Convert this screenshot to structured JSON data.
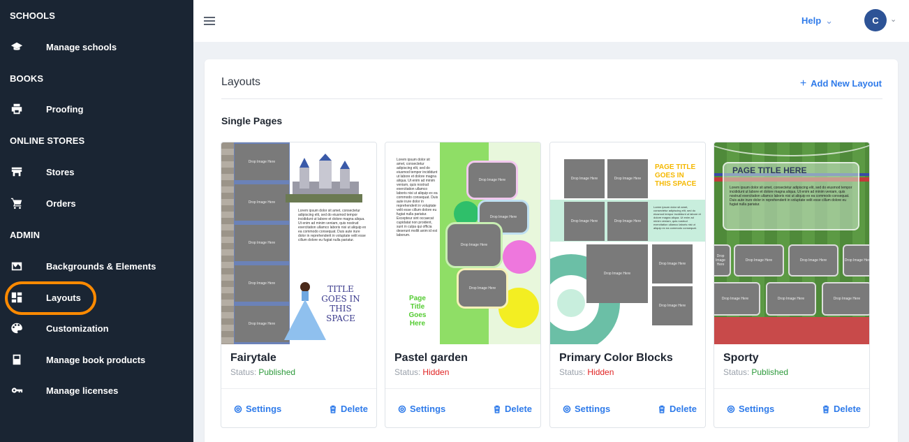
{
  "sidebar": {
    "sections": [
      {
        "title": "SCHOOLS"
      },
      {
        "title": "BOOKS"
      },
      {
        "title": "ONLINE STORES"
      },
      {
        "title": "ADMIN"
      }
    ],
    "items": [
      {
        "label": "Manage schools",
        "icon": "graduation-cap-icon"
      },
      {
        "label": "Proofing",
        "icon": "printer-icon"
      },
      {
        "label": "Stores",
        "icon": "store-icon"
      },
      {
        "label": "Orders",
        "icon": "cart-icon"
      },
      {
        "label": "Backgrounds & Elements",
        "icon": "image-icon"
      },
      {
        "label": "Layouts",
        "icon": "layout-icon"
      },
      {
        "label": "Customization",
        "icon": "palette-icon"
      },
      {
        "label": "Manage book products",
        "icon": "book-icon"
      },
      {
        "label": "Manage licenses",
        "icon": "key-icon"
      }
    ],
    "active_item": "Layouts",
    "highlight_color": "#ff8a00"
  },
  "topbar": {
    "help_label": "Help",
    "avatar_initial": "C"
  },
  "main": {
    "title": "Layouts",
    "add_button": "Add New Layout",
    "subheading": "Single Pages",
    "status_prefix": "Status:",
    "settings_label": "Settings",
    "delete_label": "Delete",
    "cards": [
      {
        "name": "Fairytale",
        "status": "Published",
        "status_color": "#2e9a3c"
      },
      {
        "name": "Pastel garden",
        "status": "Hidden",
        "status_color": "#e02424"
      },
      {
        "name": "Primary Color Blocks",
        "status": "Hidden",
        "status_color": "#e02424"
      },
      {
        "name": "Sporty",
        "status": "Published",
        "status_color": "#2e9a3c"
      }
    ]
  },
  "thumbs": {
    "drop_label": "Drop Image Here",
    "fairytale_title": "TITLE GOES IN THIS SPACE",
    "pastel_title": "Page Title Goes Here",
    "primary_title": "PAGE TITLE GOES IN THIS SPACE",
    "sporty_title": "PAGE TITLE HERE"
  },
  "colors": {
    "sidebar_bg": "#1a2533",
    "accent": "#2f7bea",
    "avatar": "#2d5396"
  }
}
